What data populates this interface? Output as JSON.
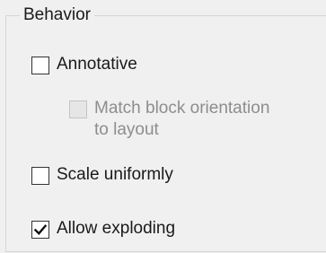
{
  "group": {
    "title": "Behavior"
  },
  "options": [
    {
      "label": "Annotative",
      "checked": false,
      "enabled": true
    },
    {
      "label_line1": "Match block orientation",
      "label_line2": "to layout",
      "checked": false,
      "enabled": false
    },
    {
      "label": "Scale uniformly",
      "checked": false,
      "enabled": true
    },
    {
      "label": "Allow exploding",
      "checked": true,
      "enabled": true
    }
  ],
  "icons": {
    "checkmark": "checkmark-icon"
  }
}
